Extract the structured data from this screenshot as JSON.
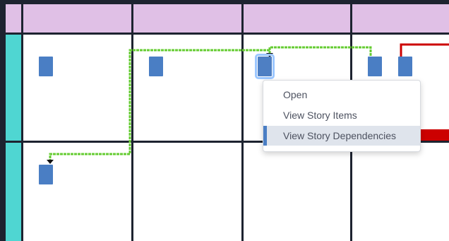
{
  "board": {
    "colors": {
      "header": "#e0c0e6",
      "swimlane": "#4fd6d2",
      "card": "#4a7ec4",
      "dependency_line": "#66cc33",
      "blocked_line": "#cc0000",
      "grid_line": "#b5b5b5"
    }
  },
  "context_menu": {
    "items": [
      {
        "label": "Open"
      },
      {
        "label": "View Story Items"
      },
      {
        "label": "View Story Dependencies"
      }
    ]
  }
}
